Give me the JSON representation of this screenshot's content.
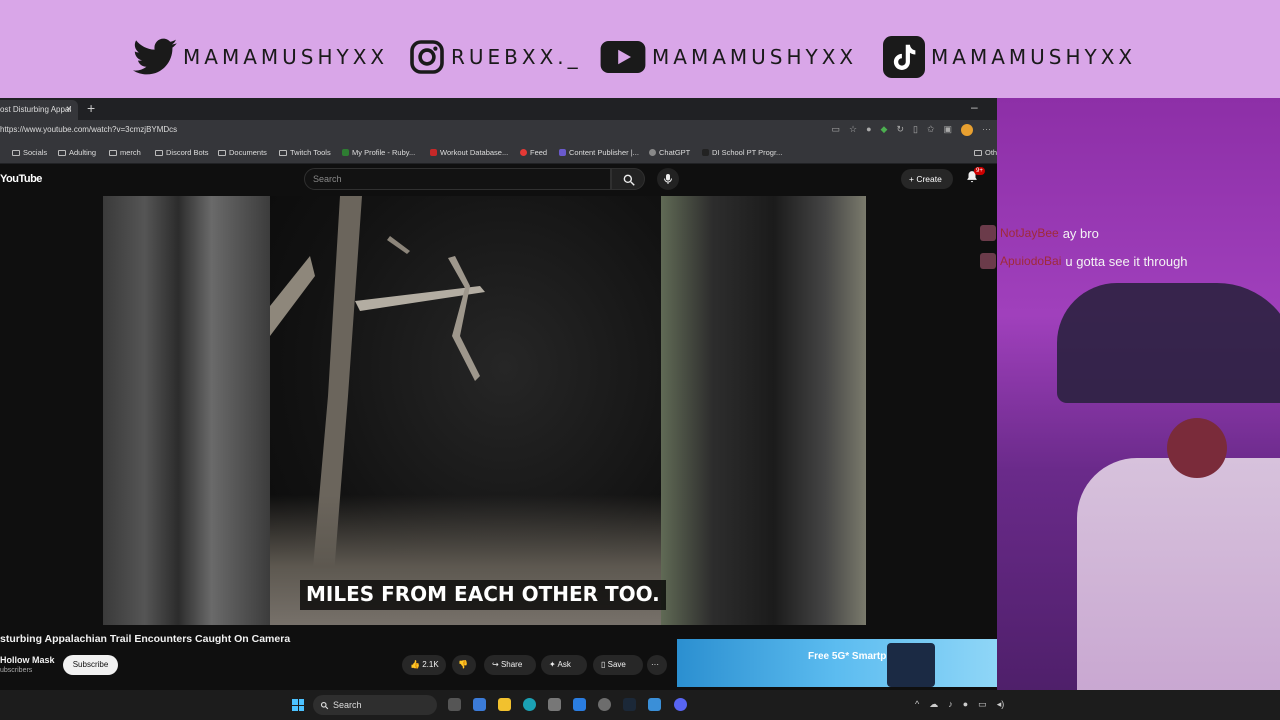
{
  "banner": {
    "twitter": "MAMAMUSHYXX",
    "instagram": "RUEBXX._",
    "youtube": "MAMAMUSHYXX",
    "tiktok": "MAMAMUSHYXX",
    "bg_color": "#d9a6e8"
  },
  "browser": {
    "tab_title": "ost Disturbing Appal",
    "tab_close": "×",
    "new_tab": "+",
    "minimize": "–",
    "url": "https://www.youtube.com/watch?v=3cmzjBYMDcs",
    "bookmarks": [
      {
        "label": "Socials"
      },
      {
        "label": "Adulting"
      },
      {
        "label": "merch"
      },
      {
        "label": "Discord Bots"
      },
      {
        "label": "Documents"
      },
      {
        "label": "Twitch Tools"
      },
      {
        "label": "My Profile - Ruby..."
      },
      {
        "label": "Workout Database..."
      },
      {
        "label": "Feed"
      },
      {
        "label": "Content Publisher |..."
      },
      {
        "label": "ChatGPT"
      },
      {
        "label": "DI School PT Progr..."
      },
      {
        "label": "Oth"
      }
    ]
  },
  "youtube": {
    "logo": "YouTube",
    "search_placeholder": "Search",
    "create_label": "Create",
    "notif_badge": "9+",
    "subtitle": "MILES FROM EACH OTHER TOO.",
    "video_title": "sturbing Appalachian Trail Encounters Caught On Camera",
    "channel": "Hollow Mask",
    "subscribers": "ubscribers",
    "subscribe_label": "Subscribe",
    "likes": "2.1K",
    "share_label": "Share",
    "ask_label": "Ask",
    "save_label": "Save",
    "more_label": "···",
    "ad_text": "Free 5G* Smartphone"
  },
  "chat": [
    {
      "user": "NotJayBee",
      "message": "ay bro"
    },
    {
      "user": "ApuiodoBai",
      "message": "u gotta see it through"
    }
  ],
  "taskbar": {
    "search_label": "Search"
  }
}
